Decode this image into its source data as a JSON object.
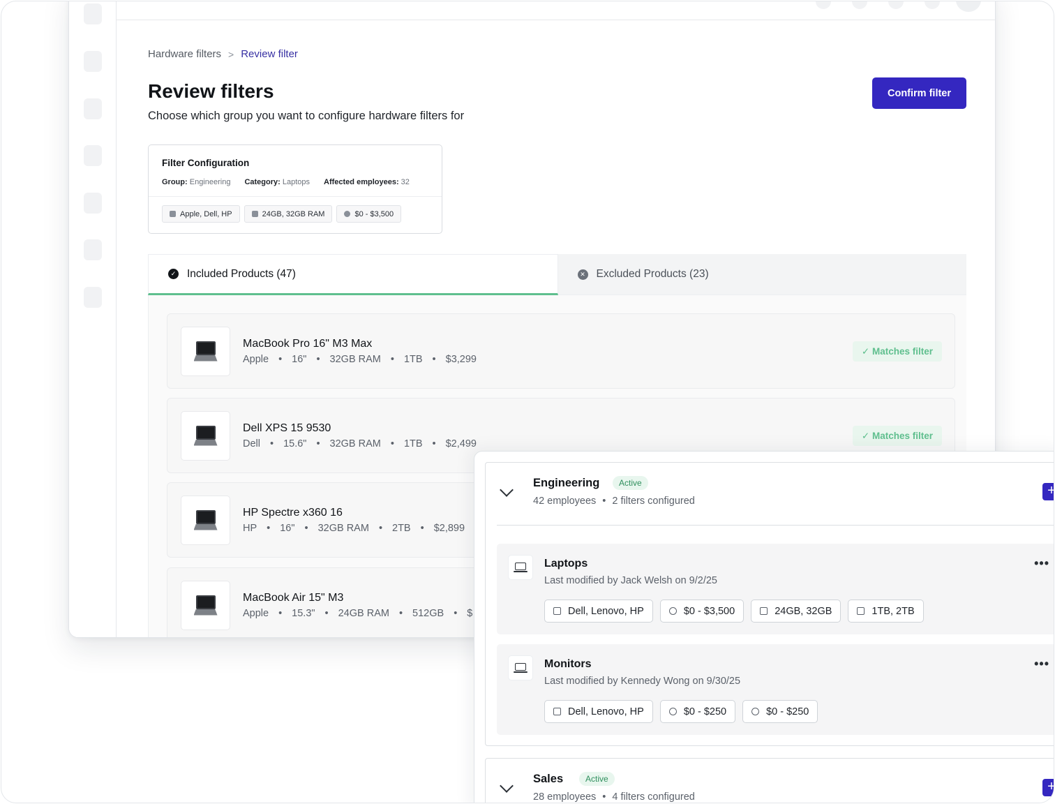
{
  "breadcrumb": {
    "parent": "Hardware filters",
    "separator": ">",
    "current": "Review filter"
  },
  "page": {
    "title": "Review filters",
    "subtitle": "Choose which group you want to configure hardware filters for",
    "confirm_label": "Confirm filter"
  },
  "filter_config": {
    "title": "Filter Configuration",
    "group_label": "Group:",
    "group_value": "Engineering",
    "category_label": "Category:",
    "category_value": "Laptops",
    "affected_label": "Affected employees:",
    "affected_value": "32",
    "chips": [
      "Apple, Dell, HP",
      "24GB, 32GB RAM",
      "$0 - $3,500"
    ]
  },
  "tabs": {
    "included": "Included Products (47)",
    "excluded": "Excluded Products (23)"
  },
  "products": [
    {
      "name": "MacBook Pro 16\" M3 Max",
      "brand": "Apple",
      "size": "16\"",
      "ram": "32GB RAM",
      "storage": "1TB",
      "price": "$3,299",
      "badge": "✓ Matches filter"
    },
    {
      "name": "Dell XPS 15 9530",
      "brand": "Dell",
      "size": "15.6\"",
      "ram": "32GB RAM",
      "storage": "1TB",
      "price": "$2,499",
      "badge": "✓ Matches filter"
    },
    {
      "name": "HP Spectre x360 16",
      "brand": "HP",
      "size": "16\"",
      "ram": "32GB RAM",
      "storage": "2TB",
      "price": "$2,899"
    },
    {
      "name": "MacBook Air 15\" M3",
      "brand": "Apple",
      "size": "15.3\"",
      "ram": "24GB RAM",
      "storage": "512GB",
      "price": "$"
    }
  ],
  "groups": [
    {
      "name": "Engineering",
      "status": "Active",
      "employees": "42 employees",
      "filters": "2 filters configured",
      "rows": [
        {
          "title": "Laptops",
          "modified": "Last modified by Jack Welsh on 9/2/25",
          "chips": [
            "Dell, Lenovo, HP",
            "$0 - $3,500",
            "24GB, 32GB",
            "1TB, 2TB"
          ]
        },
        {
          "title": "Monitors",
          "modified": "Last modified by Kennedy Wong on 9/30/25",
          "chips": [
            "Dell, Lenovo, HP",
            "$0 - $250",
            "$0 - $250"
          ]
        }
      ]
    },
    {
      "name": "Sales",
      "status": "Active",
      "employees": "28 employees",
      "filters": "4 filters configured"
    }
  ],
  "misc": {
    "dot": "•",
    "more": "•••",
    "plus": "+"
  },
  "colors": {
    "primary": "#3427c0",
    "success": "#5fbf8e",
    "badge_bg": "#e8f6ee"
  }
}
